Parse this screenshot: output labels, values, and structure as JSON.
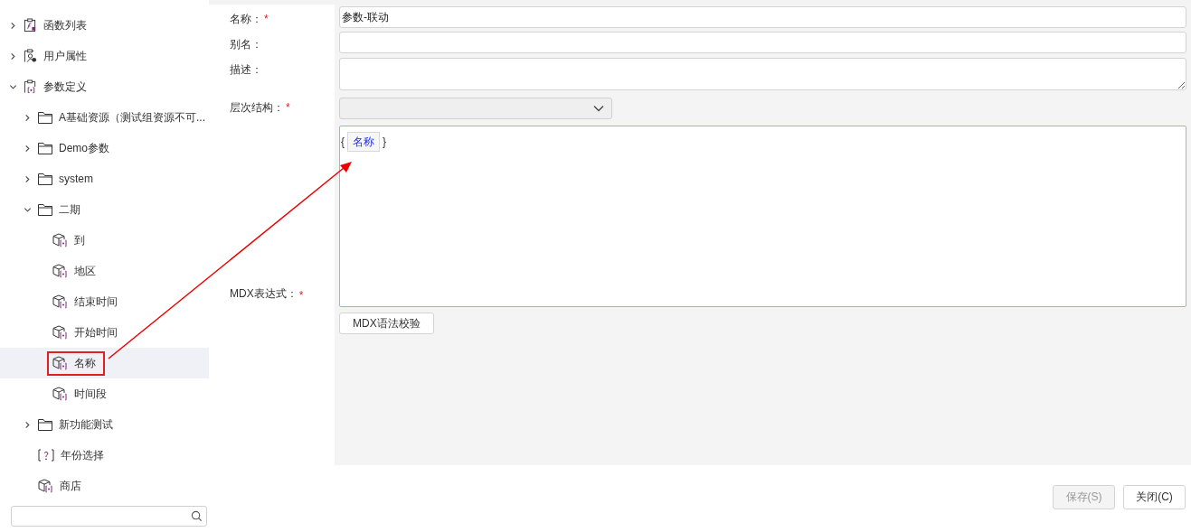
{
  "tree": [
    {
      "label": "函数列表",
      "kind": "functions",
      "expanded": false,
      "selected": false
    },
    {
      "label": "用户属性",
      "kind": "user",
      "expanded": false,
      "selected": false
    },
    {
      "label": "参数定义",
      "kind": "params",
      "expanded": true,
      "selected": false,
      "children": [
        {
          "label": "A基础资源（测试组资源不可...",
          "kind": "folder",
          "expanded": false,
          "selected": false
        },
        {
          "label": "Demo参数",
          "kind": "folder",
          "expanded": false,
          "selected": false
        },
        {
          "label": "system",
          "kind": "folder",
          "expanded": false,
          "selected": false
        },
        {
          "label": "二期",
          "kind": "folder",
          "expanded": true,
          "selected": false,
          "children": [
            {
              "label": "到",
              "kind": "cube",
              "selected": false
            },
            {
              "label": "地区",
              "kind": "cube",
              "selected": false
            },
            {
              "label": "结束时间",
              "kind": "cube",
              "selected": false
            },
            {
              "label": "开始时间",
              "kind": "cube",
              "selected": false
            },
            {
              "label": "名称",
              "kind": "cube",
              "selected": true,
              "annotated": true
            },
            {
              "label": "时间段",
              "kind": "cube",
              "selected": false
            }
          ]
        },
        {
          "label": "新功能测试",
          "kind": "folder",
          "expanded": false,
          "selected": false
        },
        {
          "label": "年份选择",
          "kind": "param",
          "selected": false
        },
        {
          "label": "商店",
          "kind": "cube",
          "selected": false
        }
      ]
    }
  ],
  "form": {
    "fields": [
      {
        "label": "名称：",
        "required_mark": "*",
        "kind": "text",
        "value": "参数-联动"
      },
      {
        "label": "别名：",
        "kind": "text"
      },
      {
        "label": "描述：",
        "kind": "textarea"
      },
      {
        "label": "层次结构：",
        "required_mark": "*",
        "kind": "select",
        "disabled": true
      }
    ],
    "mdx": {
      "label": "MDX表达式：",
      "required_mark": "*",
      "prefix": "{",
      "token": "名称",
      "suffix": "}"
    },
    "check_button": "MDX语法校验"
  },
  "buttons": [
    {
      "label": "保存(S)",
      "disabled": true
    },
    {
      "label": "关闭(C)",
      "disabled": false
    }
  ]
}
